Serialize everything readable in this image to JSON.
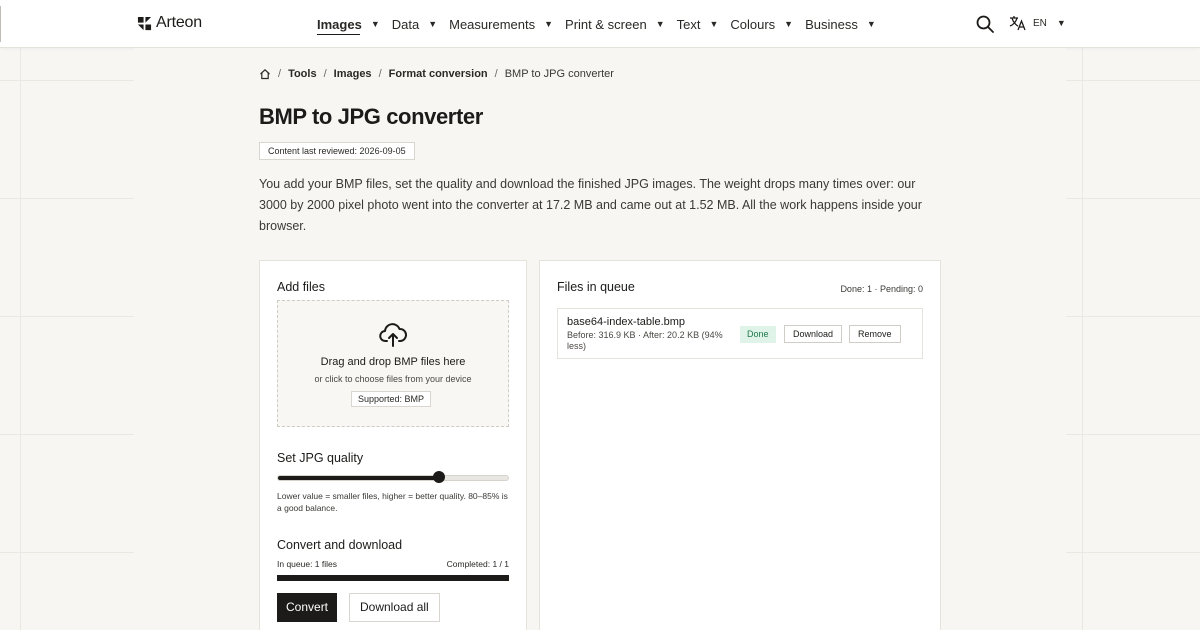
{
  "header": {
    "brand": "Arteon",
    "nav": [
      {
        "label": "Images",
        "active": true
      },
      {
        "label": "Data"
      },
      {
        "label": "Measurements"
      },
      {
        "label": "Print & screen"
      },
      {
        "label": "Text"
      },
      {
        "label": "Colours"
      },
      {
        "label": "Business"
      }
    ],
    "caret": "▼",
    "language": "EN"
  },
  "breadcrumb": {
    "items": [
      "Tools",
      "Images",
      "Format conversion"
    ],
    "current": "BMP to JPG converter",
    "separator": "/"
  },
  "page": {
    "title": "BMP to JPG converter",
    "reviewed": "Content last reviewed: 2026-09-05",
    "intro": "You add your BMP files, set the quality and download the finished JPG images. The weight drops many times over: our 3000 by 2000 pixel photo went into the converter at 17.2 MB and came out at 1.52 MB. All the work happens inside your browser."
  },
  "upload": {
    "heading": "Add files",
    "drop_title": "Drag and drop BMP files here",
    "drop_sub": "or click to choose files from your device",
    "supported": "Supported: BMP"
  },
  "quality": {
    "heading": "Set JPG quality",
    "value_fraction": 0.7,
    "hint": "Lower value = smaller files, higher = better quality. 80–85% is a good balance."
  },
  "convert": {
    "heading": "Convert and download",
    "in_queue": "In queue: 1 files",
    "completed": "Completed: 1 / 1",
    "progress_fraction": 1.0,
    "convert_label": "Convert",
    "download_all_label": "Download all"
  },
  "queue": {
    "heading": "Files in queue",
    "counts": "Done: 1 · Pending: 0",
    "files": [
      {
        "name": "base64-index-table.bmp",
        "meta": "Before: 316.9 KB · After: 20.2 KB (94% less)",
        "status": "Done",
        "download_label": "Download",
        "remove_label": "Remove"
      }
    ]
  },
  "colors": {
    "accent": "#1c1b19",
    "done_bg": "#dff3e8",
    "done_text": "#1f7a4a",
    "page_bg": "#f7f6f3"
  },
  "icons": [
    "home-icon",
    "search-icon",
    "translate-icon",
    "upload-cloud-icon",
    "logo-icon"
  ]
}
